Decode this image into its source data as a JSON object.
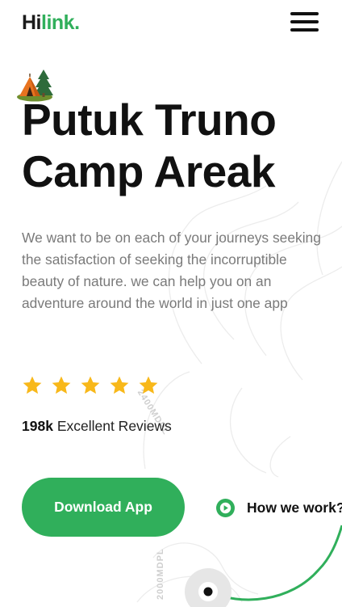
{
  "header": {
    "logo_prefix": "Hi",
    "logo_suffix": "link."
  },
  "hero": {
    "icon": "camp-tent-icon",
    "title_line1": "Putuk Truno",
    "title_line2": "Camp Areak",
    "description": "We want to be on each of your journeys seeking the satisfaction of seeking the incorruptible beauty of nature. we can help you on an adventure around the world in just one app",
    "rating_stars": 5,
    "reviews_count": "198k",
    "reviews_label": "Excellent Reviews",
    "download_label": "Download App",
    "how_label": "How we work?"
  },
  "map": {
    "label_upper": "2400MDPL",
    "label_lower": "2000MDPL"
  },
  "colors": {
    "brand_green": "#30af5b",
    "star_yellow": "#f8b81a",
    "text_dark": "#111111",
    "text_gray": "#7a7a7a"
  }
}
